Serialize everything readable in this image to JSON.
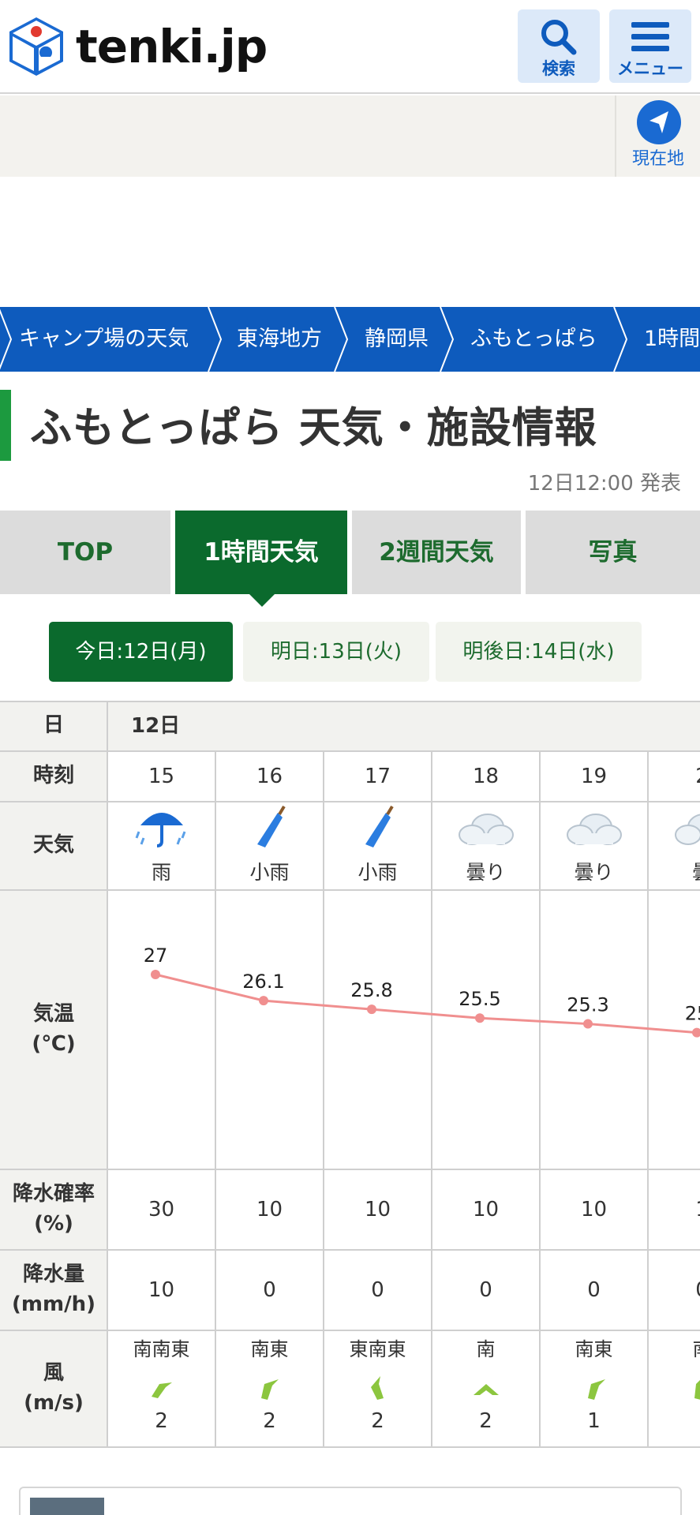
{
  "header": {
    "logo_text": "tenki.jp",
    "search_label": "検索",
    "menu_label": "メニュー"
  },
  "location_button": {
    "label": "現在地"
  },
  "breadcrumbs": [
    "キャンプ場の天気",
    "東海地方",
    "静岡県",
    "ふもとっぱら",
    "1時間"
  ],
  "page": {
    "title": "ふもとっぱら 天気・施設情報",
    "published": "12日12:00 発表"
  },
  "tabs": [
    {
      "label": "TOP",
      "active": false
    },
    {
      "label": "1時間天気",
      "active": true
    },
    {
      "label": "2週間天気",
      "active": false
    },
    {
      "label": "写真",
      "active": false
    }
  ],
  "days": [
    {
      "label": "今日:12日(月)",
      "active": true
    },
    {
      "label": "明日:13日(火)",
      "active": false
    },
    {
      "label": "明後日:14日(水)",
      "active": false
    }
  ],
  "table": {
    "row_labels": {
      "day": "日",
      "time": "時刻",
      "weather": "天気",
      "temp": "気温\n(℃)",
      "precip_prob": "降水確率\n(%)",
      "precip_amount": "降水量\n(mm/h)",
      "wind": "風\n(m/s)"
    },
    "day_value": "12日",
    "hours": [
      "15",
      "16",
      "17",
      "18",
      "19",
      "2"
    ],
    "weather": [
      {
        "icon": "umbrella-rain-icon",
        "label": "雨"
      },
      {
        "icon": "closed-umbrella-icon",
        "label": "小雨"
      },
      {
        "icon": "closed-umbrella-icon",
        "label": "小雨"
      },
      {
        "icon": "cloud-icon",
        "label": "曇り"
      },
      {
        "icon": "cloud-icon",
        "label": "曇り"
      },
      {
        "icon": "cloud-icon",
        "label": "曇"
      }
    ],
    "temps": [
      27,
      26.1,
      25.8,
      25.5,
      25.3,
      25
    ],
    "temp_labels": [
      "27",
      "26.1",
      "25.8",
      "25.5",
      "25.3",
      "25"
    ],
    "precip_prob": [
      "30",
      "10",
      "10",
      "10",
      "10",
      "1"
    ],
    "precip_amount": [
      "10",
      "0",
      "0",
      "0",
      "0",
      "0"
    ],
    "wind_dir": [
      "南南東",
      "南東",
      "東南東",
      "南",
      "南東",
      "南"
    ],
    "wind_speed": [
      "2",
      "2",
      "2",
      "2",
      "1",
      ""
    ]
  },
  "colors": {
    "brand_blue": "#0e5bbd",
    "tab_green": "#0b6a2d",
    "temp_line": "#f08f8f",
    "wind_arrow": "#8cc63f"
  }
}
